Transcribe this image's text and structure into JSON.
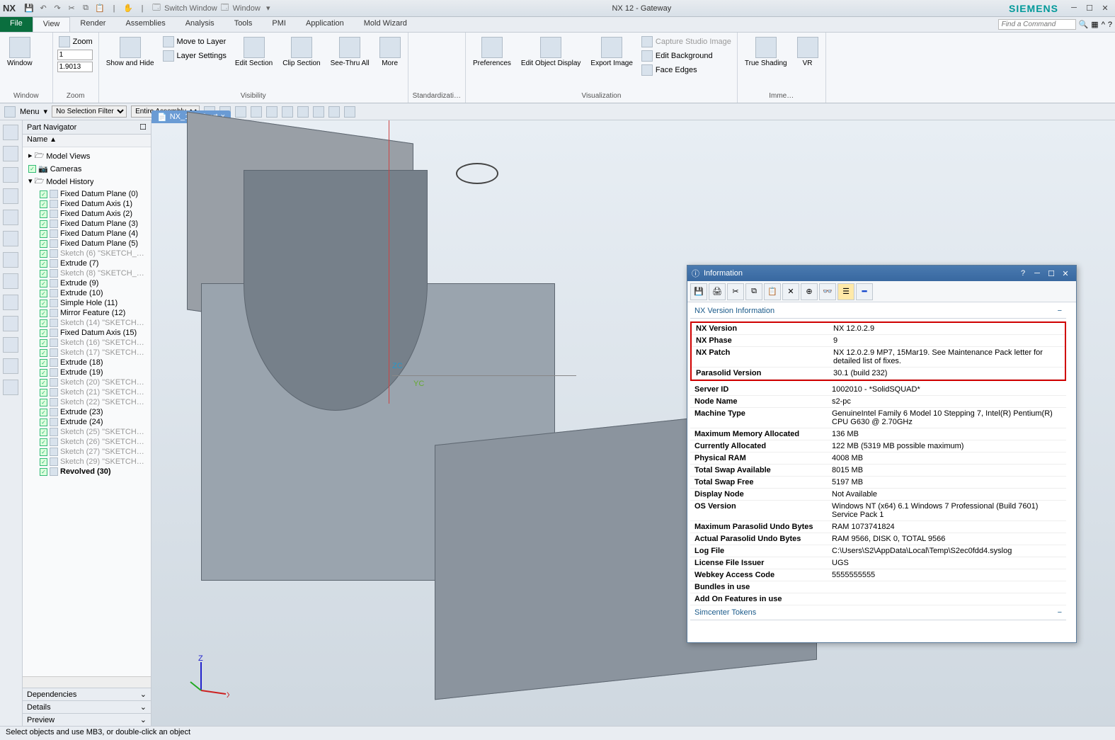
{
  "titlebar": {
    "app": "NX",
    "title": "NX 12 - Gateway",
    "brand": "SIEMENS",
    "switch_window": "Switch Window",
    "window_menu": "Window"
  },
  "tabs": {
    "file": "File",
    "view": "View",
    "render": "Render",
    "assemblies": "Assemblies",
    "analysis": "Analysis",
    "tools": "Tools",
    "pmi": "PMI",
    "application": "Application",
    "mold": "Mold Wizard"
  },
  "search_placeholder": "Find a Command",
  "ribbon": {
    "window": {
      "btn": "Window",
      "label": "Window"
    },
    "zoom": {
      "zoom": "Zoom",
      "scale": "1",
      "value": "1.9013",
      "label": "Zoom"
    },
    "visibility": {
      "show_hide": "Show\nand Hide",
      "move_layer": "Move to Layer",
      "layer_settings": "Layer Settings",
      "edit_section": "Edit\nSection",
      "clip_section": "Clip\nSection",
      "see_thru": "See-Thru\nAll",
      "more": "More",
      "label": "Visibility"
    },
    "standard": {
      "label": "Standardizati…"
    },
    "visualization": {
      "prefs": "Preferences",
      "edit_obj": "Edit Object\nDisplay",
      "export_img": "Export\nImage",
      "capture": "Capture Studio Image",
      "edit_bg": "Edit Background",
      "face_edges": "Face Edges",
      "label": "Visualization"
    },
    "shading": {
      "true_shading": "True\nShading",
      "vr": "VR",
      "label": "Imme…"
    }
  },
  "toolbar2": {
    "menu": "Menu",
    "filter": "No Selection Filter",
    "assembly": "Entire Assembly"
  },
  "navigator": {
    "title": "Part Navigator",
    "col": "Name",
    "model_views": "Model Views",
    "cameras": "Cameras",
    "model_history": "Model History",
    "items": [
      {
        "l": "Fixed Datum Plane (0)",
        "d": false
      },
      {
        "l": "Fixed Datum Axis (1)",
        "d": false
      },
      {
        "l": "Fixed Datum Axis (2)",
        "d": false
      },
      {
        "l": "Fixed Datum Plane (3)",
        "d": false
      },
      {
        "l": "Fixed Datum Plane (4)",
        "d": false
      },
      {
        "l": "Fixed Datum Plane (5)",
        "d": false
      },
      {
        "l": "Sketch (6) \"SKETCH_0…",
        "d": true
      },
      {
        "l": "Extrude (7)",
        "d": false
      },
      {
        "l": "Sketch (8) \"SKETCH_0…",
        "d": true
      },
      {
        "l": "Extrude (9)",
        "d": false
      },
      {
        "l": "Extrude (10)",
        "d": false
      },
      {
        "l": "Simple Hole (11)",
        "d": false
      },
      {
        "l": "Mirror Feature (12)",
        "d": false
      },
      {
        "l": "Sketch (14) \"SKETCH_…",
        "d": true
      },
      {
        "l": "Fixed Datum Axis (15)",
        "d": false
      },
      {
        "l": "Sketch (16) \"SKETCH_…",
        "d": true
      },
      {
        "l": "Sketch (17) \"SKETCH_…",
        "d": true
      },
      {
        "l": "Extrude (18)",
        "d": false
      },
      {
        "l": "Extrude (19)",
        "d": false
      },
      {
        "l": "Sketch (20) \"SKETCH_…",
        "d": true
      },
      {
        "l": "Sketch (21) \"SKETCH_…",
        "d": true
      },
      {
        "l": "Sketch (22) \"SKETCH_…",
        "d": true
      },
      {
        "l": "Extrude (23)",
        "d": false
      },
      {
        "l": "Extrude (24)",
        "d": false
      },
      {
        "l": "Sketch (25) \"SKETCH_…",
        "d": true
      },
      {
        "l": "Sketch (26) \"SKETCH_…",
        "d": true
      },
      {
        "l": "Sketch (27) \"SKETCH_…",
        "d": true
      },
      {
        "l": "Sketch (29) \"SKETCH_…",
        "d": true
      },
      {
        "l": "Revolved (30)",
        "d": false,
        "b": true
      }
    ],
    "deps": "Dependencies",
    "details": "Details",
    "preview": "Preview"
  },
  "viewport": {
    "tab": "NX_12.0.0.prt"
  },
  "info": {
    "title": "Information",
    "section1": "NX Version Information",
    "rows_boxed": [
      {
        "k": "NX Version",
        "v": "NX 12.0.2.9"
      },
      {
        "k": "NX Phase",
        "v": "9"
      },
      {
        "k": "NX Patch",
        "v": "NX 12.0.2.9 MP7, 15Mar19. See Maintenance Pack letter for detailed list of fixes."
      },
      {
        "k": "Parasolid Version",
        "v": "30.1 (build 232)"
      }
    ],
    "rows": [
      {
        "k": "Server ID",
        "v": "1002010 - *SolidSQUAD*"
      },
      {
        "k": "Node Name",
        "v": "s2-pc"
      },
      {
        "k": "Machine Type",
        "v": "GenuineIntel Family 6 Model 10 Stepping 7, Intel(R) Pentium(R) CPU G630 @ 2.70GHz"
      },
      {
        "k": "Maximum Memory Allocated",
        "v": "136 MB"
      },
      {
        "k": "Currently Allocated",
        "v": "122 MB (5319 MB possible maximum)"
      },
      {
        "k": "Physical RAM",
        "v": "4008 MB"
      },
      {
        "k": "Total Swap Available",
        "v": "8015 MB"
      },
      {
        "k": "Total Swap Free",
        "v": "5197 MB"
      },
      {
        "k": "Display Node",
        "v": "Not Available"
      },
      {
        "k": "OS Version",
        "v": "Windows NT (x64) 6.1 Windows 7 Professional (Build 7601) Service Pack 1"
      },
      {
        "k": "Maximum Parasolid Undo Bytes",
        "v": "RAM 1073741824"
      },
      {
        "k": "Actual Parasolid Undo Bytes",
        "v": "RAM 9566, DISK 0, TOTAL 9566"
      },
      {
        "k": "Log File",
        "v": "C:\\Users\\S2\\AppData\\Local\\Temp\\S2ec0fdd4.syslog"
      },
      {
        "k": "License File Issuer",
        "v": "UGS"
      },
      {
        "k": "Webkey Access Code",
        "v": "5555555555"
      },
      {
        "k": "Bundles in use",
        "v": ""
      },
      {
        "k": "Add On Features in use",
        "v": ""
      }
    ],
    "section2": "Simcenter Tokens"
  },
  "status": "Select objects and use MB3, or double-click an object"
}
